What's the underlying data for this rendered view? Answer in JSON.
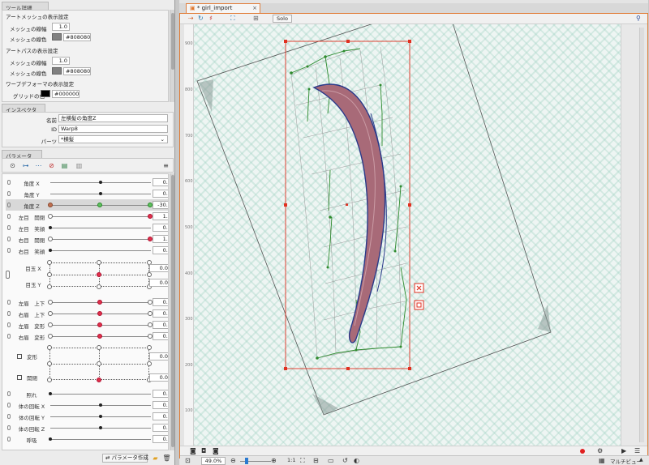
{
  "tool_details": {
    "tab": "ツール詳細",
    "artmesh_header": "アートメッシュの表示設定",
    "artmesh_line_width_label": "メッシュの線幅",
    "artmesh_line_width": "1.0",
    "artmesh_line_color_label": "メッシュの線色",
    "artmesh_line_color": "#808080",
    "artpath_header": "アートパスの表示設定",
    "artpath_line_width_label": "メッシュの線幅",
    "artpath_line_width": "1.0",
    "artpath_line_color_label": "メッシュの線色",
    "artpath_line_color": "#808080",
    "warp_header": "ワープデフォーマの表示設定",
    "warp_grid_color_label": "グリッドの色",
    "warp_grid_color": "#000000"
  },
  "inspector": {
    "tab": "インスペクタ",
    "name_label": "名前",
    "name_value": "左横髪の角度Z",
    "id_label": "ID",
    "id_value": "Warp8",
    "parts_label": "パーツ",
    "parts_value": "*横髪"
  },
  "parameters": {
    "tab": "パラメータ",
    "rows": [
      {
        "label": "角度 X",
        "value": "0.0"
      },
      {
        "label": "角度 Y",
        "value": "0.0"
      },
      {
        "label": "角度 Z",
        "value": "-30.0"
      },
      {
        "label": "左目　開閉",
        "value": "1.0"
      },
      {
        "label": "左目　笑顔",
        "value": "0.0"
      },
      {
        "label": "右目　開閉",
        "value": "1.0"
      },
      {
        "label": "右目　笑顔",
        "value": "0.0"
      },
      {
        "label": "目玉 X",
        "value": "0.0"
      },
      {
        "label": "目玉 Y",
        "value": "0.0"
      },
      {
        "label": "左眉　上下",
        "value": "0.0"
      },
      {
        "label": "右眉　上下",
        "value": "0.0"
      },
      {
        "label": "左眉　変形",
        "value": "0.0"
      },
      {
        "label": "右眉　変形",
        "value": "0.0"
      },
      {
        "label": "変形",
        "value": "0.0"
      },
      {
        "label": "開閉",
        "value": "0.0"
      },
      {
        "label": "照れ",
        "value": "0.0"
      },
      {
        "label": "体の回転 X",
        "value": "0.0"
      },
      {
        "label": "体の回転 Y",
        "value": "0.0"
      },
      {
        "label": "体の回転 Z",
        "value": "0.0"
      },
      {
        "label": "呼吸",
        "value": "0.0"
      }
    ],
    "create_button": "パラメータ作成"
  },
  "document": {
    "tab_title": "* girl_import",
    "solo_label": "Solo",
    "ruler_ticks": [
      "900",
      "800",
      "700",
      "600",
      "500",
      "400",
      "300",
      "200",
      "100"
    ]
  },
  "status": {
    "zoom": "49.0%",
    "ratio": "1:1",
    "view_mode": "マルチビュー"
  },
  "colors": {
    "accent": "#e07830",
    "mesh_green": "#2e8b2e",
    "bbox_red": "#e03020",
    "hair_fill": "#a86a78",
    "hair_outline": "#2a3a8a"
  }
}
